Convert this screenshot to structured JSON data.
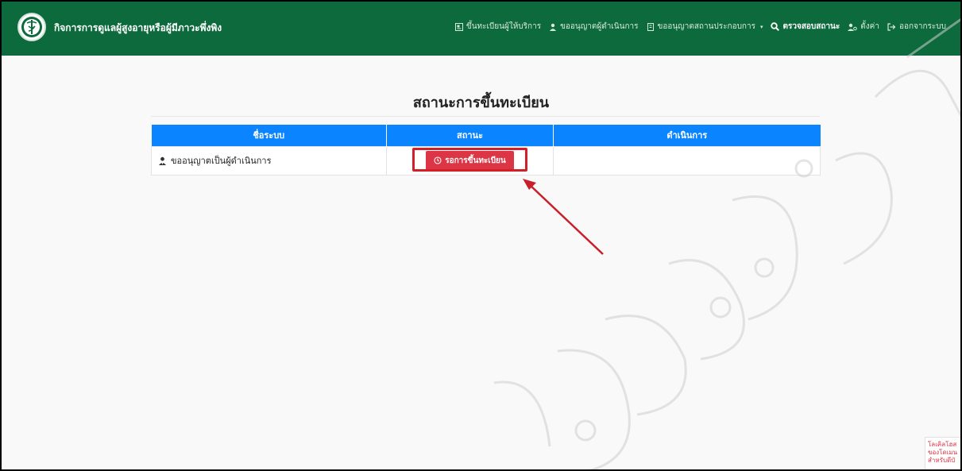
{
  "navbar": {
    "brand": "กิจการการดูแลผู้สูงอายุหรือผู้มีภาวะพึ่งพิง",
    "menu": [
      {
        "label": "ขึ้นทะเบียนผู้ให้บริการ",
        "icon": "id-card-icon"
      },
      {
        "label": "ขออนุญาตผู้ดำเนินการ",
        "icon": "user-tie-icon"
      },
      {
        "label": "ขออนุญาตสถานประกอบการ",
        "icon": "building-icon",
        "dropdown": true
      },
      {
        "label": "ตรวจสอบสถานะ",
        "icon": "search-icon",
        "active": true
      },
      {
        "label": "ตั้งค่า",
        "icon": "user-cog-icon"
      },
      {
        "label": "ออกจากระบบ",
        "icon": "sign-out-icon"
      }
    ]
  },
  "page": {
    "title": "สถานะการขึ้นทะเบียน"
  },
  "table": {
    "headers": [
      "ชื่อระบบ",
      "สถานะ",
      "ดำเนินการ"
    ],
    "rows": [
      {
        "name": "ขออนุญาตเป็นผู้ดำเนินการ",
        "status": "รอการขึ้นทะเบียน",
        "action": ""
      }
    ]
  },
  "side_tip": {
    "line1": "โลเคิลโฮส",
    "line2": "ของโดเมน",
    "line3": "สำหรับดีบั"
  },
  "colors": {
    "navbar": "#0d6a3c",
    "table_header": "#0a84ff",
    "status_badge": "#dc3545",
    "annotation": "#d0212b"
  }
}
